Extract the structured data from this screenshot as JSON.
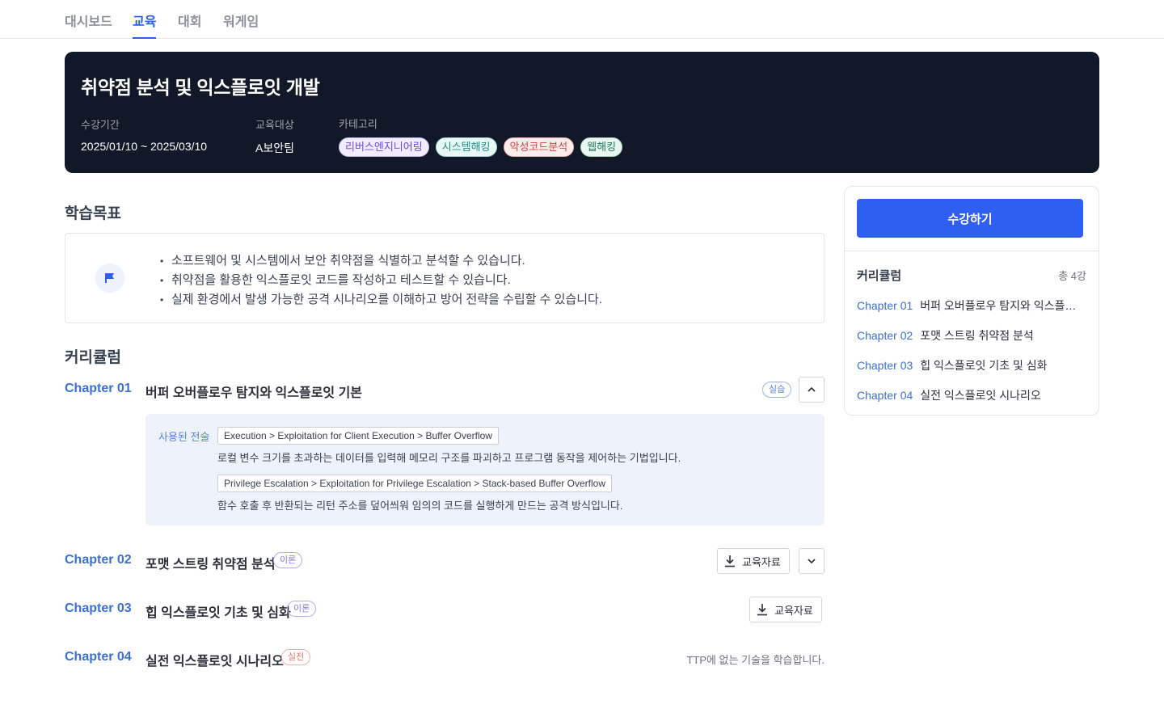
{
  "nav": {
    "tabs": [
      "대시보드",
      "교육",
      "대회",
      "워게임"
    ],
    "active": "교육"
  },
  "course": {
    "title": "취약점 분석 및 익스플로잇 개발",
    "period_label": "수강기간",
    "period_value": "2025/01/10 ~ 2025/03/10",
    "target_label": "교육대상",
    "target_value": "A보안팀",
    "category_label": "카테고리",
    "categories": [
      {
        "label": "리버스엔지니어링",
        "color": "#6d4ad4",
        "bg": "#f1edff",
        "border": "#c9bdf5"
      },
      {
        "label": "시스템해킹",
        "color": "#1b8f8a",
        "bg": "#e8f8f7",
        "border": "#a5dbd8"
      },
      {
        "label": "악성코드분석",
        "color": "#d64545",
        "bg": "#fdecec",
        "border": "#f3b9b9"
      },
      {
        "label": "웹해킹",
        "color": "#1f7a5c",
        "bg": "#eaf6f0",
        "border": "#a9d9c3"
      }
    ]
  },
  "goals": {
    "heading": "학습목표",
    "icon": "flag-icon",
    "items": [
      "소프트웨어 및 시스템에서 보안 취약점을 식별하고 분석할 수 있습니다.",
      "취약점을 활용한 익스플로잇 코드를 작성하고 테스트할 수 있습니다.",
      "실제 환경에서 발생 가능한 공격 시나리오를 이해하고 방어 전략을 수립할 수 있습니다."
    ]
  },
  "curriculum": {
    "heading": "커리큘럼",
    "chapters": [
      {
        "num": "Chapter 01",
        "title": "버퍼 오버플로우 탐지와 익스플로잇 기본",
        "badge": "실습",
        "expanded": true
      },
      {
        "num": "Chapter 02",
        "title": "포맷 스트링 취약점 분석",
        "badge": "이론",
        "download": "교육자료"
      },
      {
        "num": "Chapter 03",
        "title": "힙 익스플로잇 기초 및 심화",
        "badge": "이론",
        "download": "교육자료"
      },
      {
        "num": "Chapter 04",
        "title": "실전 익스플로잇 시나리오",
        "badge": "실전",
        "note": "TTP에 없는 기술을 학습합니다."
      }
    ],
    "techniques_label": "사용된 전술",
    "techniques": [
      {
        "path": "Execution > Exploitation for Client Execution > Buffer Overflow",
        "desc": "로컬 변수 크기를 초과하는 데이터를 입력해 메모리 구조를 파괴하고 프로그램 동작을 제어하는 기법입니다."
      },
      {
        "path": "Privilege Escalation > Exploitation for Privilege Escalation > Stack-based Buffer Overflow",
        "desc": "함수 호출 후 반환되는 리턴 주소를 덮어씌워 임의의 코드를 실행하게 만드는 공격 방식입니다."
      }
    ]
  },
  "sidebar": {
    "enroll_label": "수강하기",
    "heading": "커리큘럼",
    "count": "총 4강",
    "items": [
      {
        "num": "Chapter 01",
        "title": "버퍼 오버플로우 탐지와 익스플로잇 기본"
      },
      {
        "num": "Chapter 02",
        "title": "포맷 스트링 취약점 분석"
      },
      {
        "num": "Chapter 03",
        "title": "힙 익스플로잇 기초 및 심화"
      },
      {
        "num": "Chapter 04",
        "title": "실전 익스플로잇 시나리오"
      }
    ]
  },
  "colors": {
    "accent": "#2f5ff0",
    "hero_bg": "#111827",
    "link": "#3b6fd9"
  }
}
